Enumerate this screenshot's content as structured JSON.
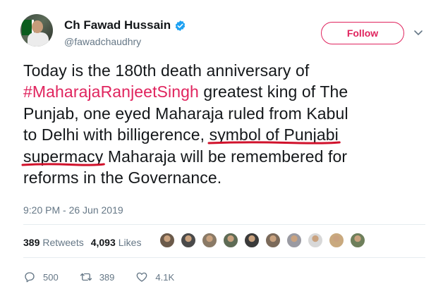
{
  "author": {
    "display_name": "Ch Fawad Hussain",
    "handle": "@fawadchaudhry",
    "verified": true,
    "avatar_icon": "profile-photo"
  },
  "follow_label": "Follow",
  "tweet": {
    "lines": [
      [
        {
          "text": "Today is the 180th death anniversary of",
          "type": "text"
        }
      ],
      [
        {
          "text": "#MaharajaRanjeetSingh",
          "type": "hashtag"
        },
        {
          "text": " greatest king of The",
          "type": "text"
        }
      ],
      [
        {
          "text": "Punjab, one eyed Maharaja ruled from Kabul",
          "type": "text"
        }
      ],
      [
        {
          "text": "to Delhi with billigerence, ",
          "type": "text"
        },
        {
          "text": "symbol of Punjabi",
          "type": "underlined"
        }
      ],
      [
        {
          "text": "supermacy",
          "type": "underlined"
        },
        {
          "text": " Maharaja will be remembered for",
          "type": "text"
        }
      ],
      [
        {
          "text": "reforms in the Governance.",
          "type": "text"
        }
      ]
    ]
  },
  "timestamp": "9:20 PM - 26 Jun 2019",
  "stats": {
    "retweets_count": "389",
    "retweets_label": "Retweets",
    "likes_count": "4,093",
    "likes_label": "Likes"
  },
  "liker_avatars": [
    "#6b5a4a",
    "#4a4a4a",
    "#8a7a66",
    "#5e6b55",
    "#3a3a3a",
    "#7b6a5a",
    "#9a9aa2",
    "#d8d8d8",
    "#c9a97e",
    "#6e7f5b"
  ],
  "actions": {
    "reply_count": "500",
    "retweet_count": "389",
    "like_count": "4.1K"
  },
  "colors": {
    "hashtag": "#e0245e",
    "verified": "#1da1f2",
    "annotation_underline": "#d0112b"
  }
}
